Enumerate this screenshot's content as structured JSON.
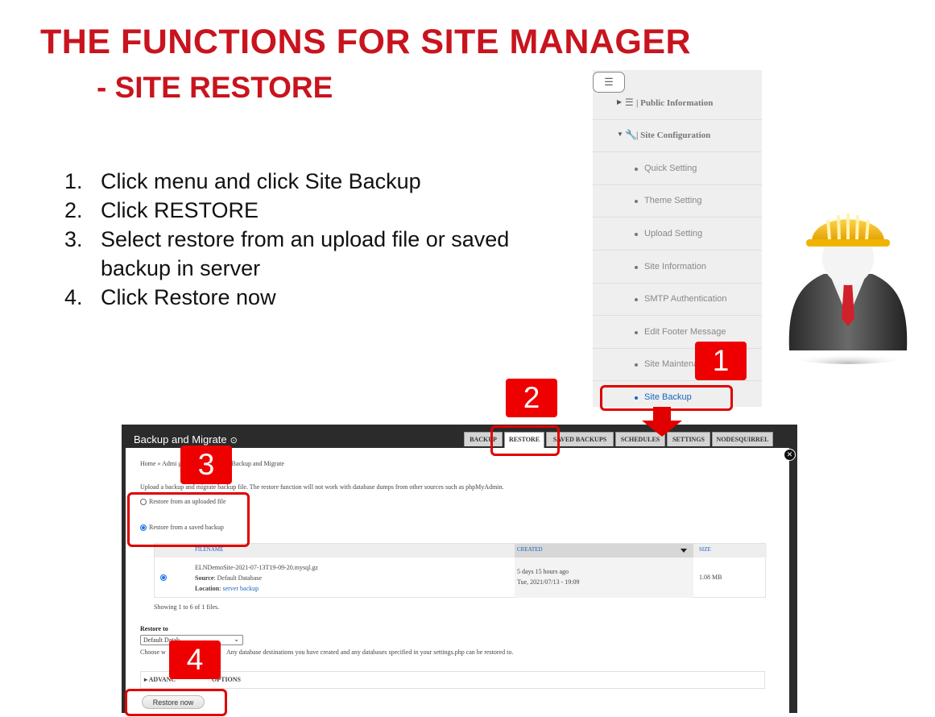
{
  "slide": {
    "title": "THE FUNCTIONS FOR SITE MANAGER",
    "subtitle": "- SITE RESTORE",
    "steps": [
      {
        "num": "1.",
        "text": "Click menu and click Site Backup"
      },
      {
        "num": "2.",
        "text": "Click RESTORE"
      },
      {
        "num": "3.",
        "text": "Select restore from an upload file or saved backup in server"
      },
      {
        "num": "4.",
        "text": "Click Restore now"
      }
    ],
    "callouts": [
      "1",
      "2",
      "3",
      "4"
    ]
  },
  "menu": {
    "toggle_icon": "hamburger-icon",
    "sections": [
      {
        "label": "| Public Information",
        "icon": "list-icon"
      },
      {
        "label": "| Site Configuration",
        "icon": "wrench-icon"
      }
    ],
    "items": [
      "Quick Setting",
      "Theme Setting",
      "Upload Setting",
      "Site Information",
      "SMTP Authentication",
      "Edit Footer Message",
      "Site Maintena",
      "Site Backup"
    ]
  },
  "panel": {
    "title": "Backup and Migrate",
    "tabs": [
      "BACKUP",
      "RESTORE",
      "SAVED BACKUPS",
      "SCHEDULES",
      "SETTINGS",
      "NODESQUIRREL"
    ],
    "active_tab": "RESTORE",
    "breadcrumb": "Home » Admi            guration » System » Backup and Migrate",
    "description": "Upload a backup and migrate backup file. The restore function will not work with database dumps from other sources such as phpMyAdmin.",
    "options": [
      "Restore from an uploaded file",
      "Restore from a saved backup"
    ],
    "selected_option": "Restore from a saved backup",
    "table": {
      "headers": [
        "FILENAME",
        "CREATED",
        "SIZE"
      ],
      "row": {
        "filename": "ELNDemoSite-2021-07-13T19-09-20.mysql.gz",
        "source_label": "Source",
        "source": ": Default Database",
        "location_label": "Location",
        "location": "server backup",
        "created_relative": "5 days 15 hours ago",
        "created_date": "Tue, 2021/07/13 - 19:09",
        "size": "1.08 MB"
      }
    },
    "showing": "Showing 1 to 6 of 1 files.",
    "restore_to_label": "Restore to",
    "restore_to_value": "Default Datab",
    "restore_help_left": "Choose w",
    "restore_help_right": "Any database destinations you have created and any databases specified in your settings.php can be restored to.",
    "advanced_label": "ADVANC",
    "advanced_label_tail": "OPTIONS",
    "restore_button": "Restore now"
  },
  "colors": {
    "accent_red": "#c8141e",
    "callout_red": "#ee0000",
    "link_blue": "#1565c0"
  }
}
